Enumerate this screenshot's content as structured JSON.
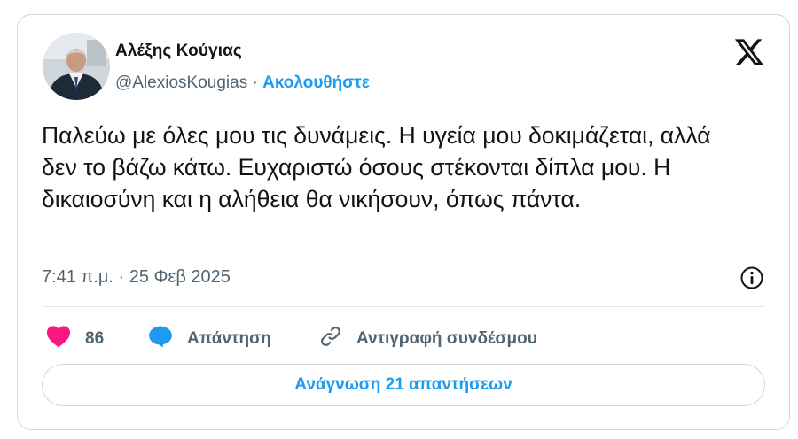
{
  "author": {
    "display_name": "Αλέξης Κούγιας",
    "handle": "@AlexiosKougias",
    "separator": "·",
    "follow_label": "Ακολουθήστε"
  },
  "platform_icon": "x-logo-icon",
  "tweet": {
    "text": "Παλεύω με όλες μου τις δυνάμεις. Η υγεία μου δοκιμάζεται, αλλά δεν το βάζω κάτω. Ευχαριστώ όσους στέκονται δίπλα μου. Η δικαιοσύνη και η αλήθεια θα νικήσουν, όπως πάντα.",
    "timestamp": "7:41 π.μ. · 25 Φεβ 2025"
  },
  "actions": {
    "likes_count": "86",
    "reply_label": "Απάντηση",
    "copy_link_label": "Αντιγραφή συνδέσμου"
  },
  "read_replies_label": "Ανάγνωση 21 απαντήσεων",
  "colors": {
    "accent": "#1d9bf0",
    "heart": "#f91880",
    "secondary_text": "#536471",
    "border": "#cfd9de"
  }
}
